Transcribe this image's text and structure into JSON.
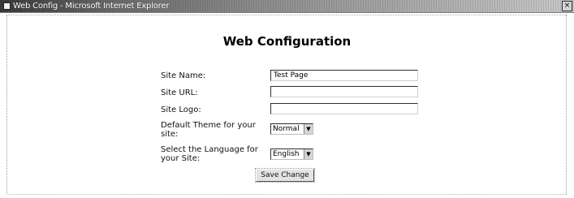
{
  "window": {
    "title": "Web Config - Microsoft Internet Explorer",
    "controls": {
      "close": "×"
    }
  },
  "page": {
    "heading": "Web Configuration"
  },
  "form": {
    "site_name": {
      "label": "Site Name:",
      "value": "Test Page"
    },
    "site_url": {
      "label": "Site URL:",
      "value": ""
    },
    "site_logo": {
      "label": "Site Logo:",
      "value": ""
    },
    "default_theme": {
      "label_line1": "Default Theme for your",
      "label_line2": "site:",
      "selected": "Normal"
    },
    "language": {
      "label_line1": "Select the Language for",
      "label_line2": "your Site:",
      "selected": "English"
    },
    "submit_label": "Save Change"
  },
  "icons": {
    "app": "ie-page-icon",
    "dropdown": "chevron-down-icon",
    "dropdown_glyph": "▼"
  }
}
